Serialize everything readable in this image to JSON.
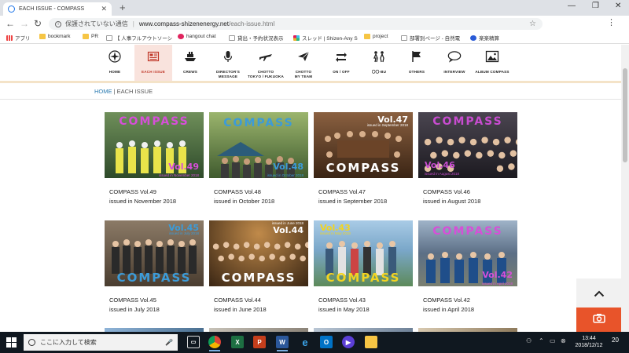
{
  "browser": {
    "tab_title": "EACH ISSUE - COMPASS",
    "security_label": "保護されていない通信",
    "url_domain": "www.compass-shizenenergy.net",
    "url_path": "/each-issue.html"
  },
  "bookmarks": [
    {
      "label": "アプリ",
      "icon": "apps-grid-icon"
    },
    {
      "label": "bookmark",
      "icon": "folder-icon"
    },
    {
      "label": "PR",
      "icon": "folder-icon"
    },
    {
      "label": "【 人事フルアウトソーシ",
      "icon": "page-icon"
    },
    {
      "label": "hangout chat",
      "icon": "hangout-icon"
    },
    {
      "label": "貸出・予約状況表示",
      "icon": "page-icon"
    },
    {
      "label": "スレッド | Shizen-Any S",
      "icon": "slack-icon"
    },
    {
      "label": "project",
      "icon": "folder-icon"
    },
    {
      "label": "部署別ページ - 自然電",
      "icon": "page-icon"
    },
    {
      "label": "楽楽精算",
      "icon": "rakuraku-icon"
    }
  ],
  "nav": [
    {
      "label": "HOME",
      "icon": "compass-icon"
    },
    {
      "label": "EACH ISSUE",
      "icon": "newspaper-icon",
      "active": true
    },
    {
      "label": "CREWS",
      "icon": "ship-icon"
    },
    {
      "label": "DIRECTOR'S\nMESSAGE",
      "icon": "microphone-icon"
    },
    {
      "label": "CHOTTO\nTOKYO / FUKUOKA",
      "icon": "airplane-icon"
    },
    {
      "label": "CHOTTO\nMY TEAM",
      "icon": "paper-plane-icon"
    },
    {
      "label": "ON / OFF",
      "icon": "switch-arrows-icon"
    },
    {
      "label": "〇〇-BU",
      "icon": "club-people-icon"
    },
    {
      "label": "OTHERS",
      "icon": "flag-icon"
    },
    {
      "label": "INTERVIEW",
      "icon": "speech-bubble-icon"
    },
    {
      "label": "ALBUM COMPASS",
      "icon": "photo-icon"
    }
  ],
  "breadcrumb": {
    "home": "HOME",
    "separator": "|",
    "current": "EACH ISSUE"
  },
  "issues": [
    {
      "title": "COMPASS Vol.49",
      "date": "issued in November 2018",
      "brand": "COMPASS",
      "vol": "Vol.49",
      "thumb_note": "issued in November 2018",
      "bg": "#2e4a2a",
      "brand_color": "#d64fd8"
    },
    {
      "title": "COMPASS Vol.48",
      "date": "issued in October 2018",
      "brand": "COMPASS",
      "vol": "Vol.48",
      "thumb_note": "issued in October 2018",
      "bg": "#3f5a2e",
      "brand_color": "#3c9bd8"
    },
    {
      "title": "COMPASS Vol.47",
      "date": "issued in September 2018",
      "brand": "COMPASS",
      "vol": "Vol.47",
      "thumb_note": "issued in September 2018",
      "bg": "#5a3a22",
      "brand_color": "#ffffff"
    },
    {
      "title": "COMPASS Vol.46",
      "date": "issued in August 2018",
      "brand": "COMPASS",
      "vol": "Vol.46",
      "thumb_note": "issued in August 2018",
      "bg": "#2c2a2f",
      "brand_color": "#c84cd0"
    },
    {
      "title": "COMPASS Vol.45",
      "date": "issued in July 2018",
      "brand": "COMPASS",
      "vol": "Vol.45",
      "thumb_note": "issued in July 2018",
      "bg": "#5b4d3c",
      "brand_color": "#3c9bd8"
    },
    {
      "title": "COMPASS Vol.44",
      "date": "issued in June 2018",
      "brand": "COMPASS",
      "vol": "Vol.44",
      "thumb_note": "issued in June 2018",
      "bg": "#4a3520",
      "brand_color": "#ffffff"
    },
    {
      "title": "COMPASS Vol.43",
      "date": "issued in May 2018",
      "brand": "COMPASS",
      "vol": "Vol.43",
      "thumb_note": "issued in May 2018",
      "bg": "#7aa7c9",
      "brand_color": "#f2d421"
    },
    {
      "title": "COMPASS Vol.42",
      "date": "issued in April 2018",
      "brand": "COMPASS",
      "vol": "Vol.42",
      "thumb_note": "issued in April 2018",
      "bg": "#5c6f86",
      "brand_color": "#d64fd8"
    }
  ],
  "taskbar": {
    "search_placeholder": "ここに入力して検索",
    "time": "13:44",
    "date": "2018/12/12",
    "notifications": "20"
  },
  "colors": {
    "accent": "#e8542a",
    "active_nav_bg": "#f9e3dd",
    "link": "#2a7ab0"
  }
}
